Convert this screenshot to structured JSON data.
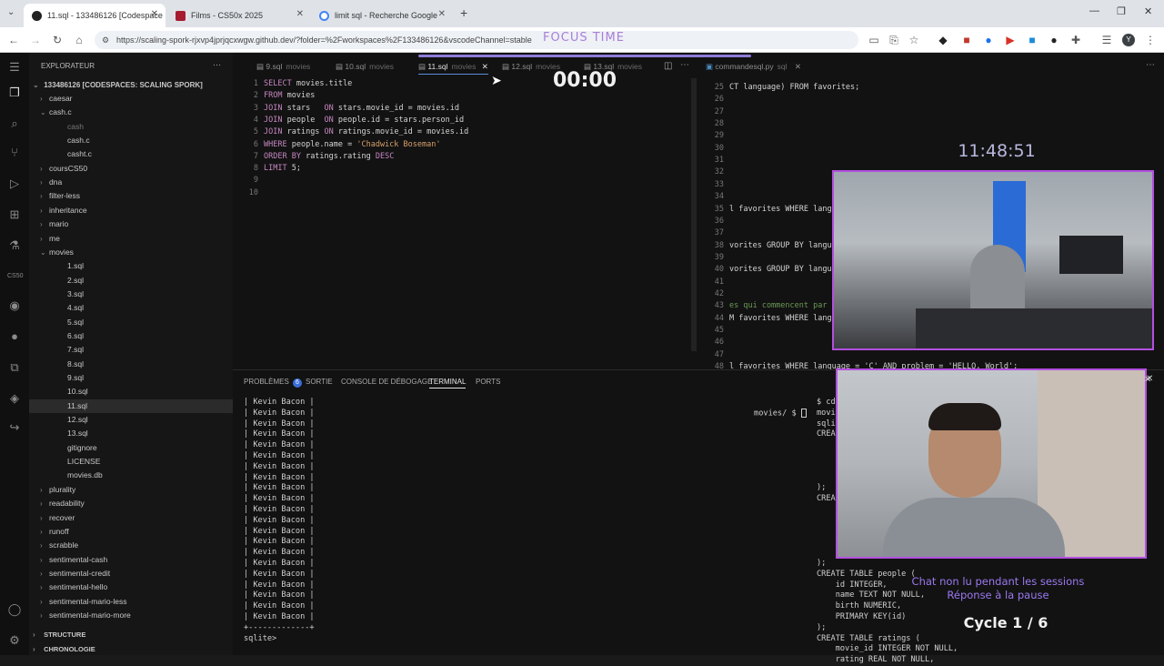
{
  "browser": {
    "tabs": [
      {
        "title": "11.sql - 133486126 [Codespace",
        "active": true
      },
      {
        "title": "Films - CS50x 2025",
        "active": false
      },
      {
        "title": "limit sql - Recherche Google",
        "active": false
      }
    ],
    "url": "https://scaling-spork-rjxvp4jprjqcxwgw.github.dev/?folder=%2Fworkspaces%2F133486126&vscodeChannel=stable"
  },
  "overlay": {
    "focus_label": "FOCUS TIME",
    "timer": "00:00",
    "clock": "11:48:51",
    "chat_line1": "Chat non lu pendant les sessions",
    "chat_line2": "Réponse à la pause",
    "cycle": "Cycle 1 / 6"
  },
  "sidebar": {
    "title": "EXPLORATEUR",
    "root": "133486126 [CODESPACES: SCALING SPORK]",
    "items": [
      {
        "label": "caesar",
        "depth": 1,
        "type": "folder",
        "open": false
      },
      {
        "label": "cash.c",
        "depth": 1,
        "type": "folder",
        "open": true
      },
      {
        "label": "cash",
        "depth": 2,
        "type": "file",
        "dim": true
      },
      {
        "label": "cash.c",
        "depth": 2,
        "type": "file"
      },
      {
        "label": "casht.c",
        "depth": 2,
        "type": "file"
      },
      {
        "label": "coursCS50",
        "depth": 1,
        "type": "folder",
        "open": false
      },
      {
        "label": "dna",
        "depth": 1,
        "type": "folder",
        "open": false
      },
      {
        "label": "filter-less",
        "depth": 1,
        "type": "folder",
        "open": false
      },
      {
        "label": "inheritance",
        "depth": 1,
        "type": "folder",
        "open": false
      },
      {
        "label": "mario",
        "depth": 1,
        "type": "folder",
        "open": false
      },
      {
        "label": "me",
        "depth": 1,
        "type": "folder",
        "open": false
      },
      {
        "label": "movies",
        "depth": 1,
        "type": "folder",
        "open": true
      },
      {
        "label": "1.sql",
        "depth": 2,
        "type": "file"
      },
      {
        "label": "2.sql",
        "depth": 2,
        "type": "file"
      },
      {
        "label": "3.sql",
        "depth": 2,
        "type": "file"
      },
      {
        "label": "4.sql",
        "depth": 2,
        "type": "file"
      },
      {
        "label": "5.sql",
        "depth": 2,
        "type": "file"
      },
      {
        "label": "6.sql",
        "depth": 2,
        "type": "file"
      },
      {
        "label": "7.sql",
        "depth": 2,
        "type": "file"
      },
      {
        "label": "8.sql",
        "depth": 2,
        "type": "file"
      },
      {
        "label": "9.sql",
        "depth": 2,
        "type": "file"
      },
      {
        "label": "10.sql",
        "depth": 2,
        "type": "file"
      },
      {
        "label": "11.sql",
        "depth": 2,
        "type": "file",
        "selected": true
      },
      {
        "label": "12.sql",
        "depth": 2,
        "type": "file"
      },
      {
        "label": "13.sql",
        "depth": 2,
        "type": "file"
      },
      {
        "label": "gitignore",
        "depth": 2,
        "type": "file"
      },
      {
        "label": "LICENSE",
        "depth": 2,
        "type": "file"
      },
      {
        "label": "movies.db",
        "depth": 2,
        "type": "file"
      },
      {
        "label": "plurality",
        "depth": 1,
        "type": "folder",
        "open": false
      },
      {
        "label": "readability",
        "depth": 1,
        "type": "folder",
        "open": false
      },
      {
        "label": "recover",
        "depth": 1,
        "type": "folder",
        "open": false
      },
      {
        "label": "runoff",
        "depth": 1,
        "type": "folder",
        "open": false
      },
      {
        "label": "scrabble",
        "depth": 1,
        "type": "folder",
        "open": false
      },
      {
        "label": "sentimental-cash",
        "depth": 1,
        "type": "folder",
        "open": false
      },
      {
        "label": "sentimental-credit",
        "depth": 1,
        "type": "folder",
        "open": false
      },
      {
        "label": "sentimental-hello",
        "depth": 1,
        "type": "folder",
        "open": false
      },
      {
        "label": "sentimental-mario-less",
        "depth": 1,
        "type": "folder",
        "open": false
      },
      {
        "label": "sentimental-mario-more",
        "depth": 1,
        "type": "folder",
        "open": false
      }
    ],
    "structure": "STRUCTURE",
    "timeline": "CHRONOLOGIE"
  },
  "editor_left": {
    "tabs": [
      {
        "name": "9.sql",
        "desc": "movies"
      },
      {
        "name": "10.sql",
        "desc": "movies"
      },
      {
        "name": "11.sql",
        "desc": "movies",
        "active": true
      },
      {
        "name": "12.sql",
        "desc": "movies"
      },
      {
        "name": "13.sql",
        "desc": "movies"
      }
    ],
    "lines": [
      {
        "n": "1",
        "tokens": [
          [
            "kw",
            "SELECT"
          ],
          [
            "plain",
            " movies.title"
          ]
        ]
      },
      {
        "n": "2",
        "tokens": [
          [
            "kw",
            "FROM"
          ],
          [
            "plain",
            " movies"
          ]
        ]
      },
      {
        "n": "3",
        "tokens": [
          [
            "kw",
            "JOIN"
          ],
          [
            "plain",
            " stars   "
          ],
          [
            "kw",
            "ON"
          ],
          [
            "plain",
            " stars.movie_id = movies.id"
          ]
        ]
      },
      {
        "n": "4",
        "tokens": [
          [
            "kw",
            "JOIN"
          ],
          [
            "plain",
            " people  "
          ],
          [
            "kw",
            "ON"
          ],
          [
            "plain",
            " people.id = stars.person_id"
          ]
        ]
      },
      {
        "n": "5",
        "tokens": [
          [
            "kw",
            "JOIN"
          ],
          [
            "plain",
            " ratings "
          ],
          [
            "kw",
            "ON"
          ],
          [
            "plain",
            " ratings.movie_id = movies.id"
          ]
        ]
      },
      {
        "n": "6",
        "tokens": [
          [
            "kw",
            "WHERE"
          ],
          [
            "plain",
            " people.name = "
          ],
          [
            "str",
            "'Chadwick Boseman'"
          ]
        ]
      },
      {
        "n": "7",
        "tokens": [
          [
            "kw",
            "ORDER BY"
          ],
          [
            "plain",
            " ratings.rating "
          ],
          [
            "kw",
            "DESC"
          ]
        ]
      },
      {
        "n": "8",
        "tokens": [
          [
            "kw",
            "LIMIT"
          ],
          [
            "plain",
            " 5;"
          ]
        ]
      },
      {
        "n": "9",
        "tokens": []
      },
      {
        "n": "10",
        "tokens": []
      }
    ]
  },
  "editor_right": {
    "tab": {
      "name": "commandesql.py",
      "desc": "sql"
    },
    "lines": [
      {
        "n": "25",
        "text": "CT language) FROM favorites;"
      },
      {
        "n": "26",
        "text": ""
      },
      {
        "n": "27",
        "text": ""
      },
      {
        "n": "28",
        "text": ""
      },
      {
        "n": "29",
        "text": ""
      },
      {
        "n": "30",
        "text": ""
      },
      {
        "n": "31",
        "text": ""
      },
      {
        "n": "32",
        "text": ""
      },
      {
        "n": "33",
        "text": ""
      },
      {
        "n": "34",
        "text": ""
      },
      {
        "n": "35",
        "text": "l favorites WHERE langu"
      },
      {
        "n": "36",
        "text": ""
      },
      {
        "n": "37",
        "text": ""
      },
      {
        "n": "38",
        "text": "vorites GROUP BY langu"
      },
      {
        "n": "39",
        "text": ""
      },
      {
        "n": "40",
        "text": "vorites GROUP BY langu"
      },
      {
        "n": "41",
        "text": ""
      },
      {
        "n": "42",
        "text": ""
      },
      {
        "n": "43",
        "text": "es qui commencent par"
      },
      {
        "n": "44",
        "text": "M favorites WHERE lang"
      },
      {
        "n": "45",
        "text": ""
      },
      {
        "n": "46",
        "text": ""
      },
      {
        "n": "47",
        "text": ""
      },
      {
        "n": "48",
        "text": "l favorites WHERE language = 'C' AND problem = 'HELLO, World';"
      }
    ]
  },
  "panel": {
    "tabs": [
      "PROBLÈMES",
      "SORTIE",
      "CONSOLE DE DÉBOGAGE",
      "TERMINAL",
      "PORTS"
    ],
    "problems_count": "6",
    "active_tab": "TERMINAL",
    "terminal_left_lines": [
      "| Kevin Bacon |",
      "| Kevin Bacon |",
      "| Kevin Bacon |",
      "| Kevin Bacon |",
      "| Kevin Bacon |",
      "| Kevin Bacon |",
      "| Kevin Bacon |",
      "| Kevin Bacon |",
      "| Kevin Bacon |",
      "| Kevin Bacon |",
      "| Kevin Bacon |",
      "| Kevin Bacon |",
      "| Kevin Bacon |",
      "| Kevin Bacon |",
      "| Kevin Bacon |",
      "| Kevin Bacon |",
      "| Kevin Bacon |",
      "| Kevin Bacon |",
      "| Kevin Bacon |",
      "| Kevin Bacon |",
      "| Kevin Bacon |",
      "+-------------+",
      "sqlite> "
    ],
    "terminal_mid": "movies/ $ ",
    "terminal_right_lines": [
      "$ cd",
      "movi",
      "sqli",
      "CREA",
      "",
      "",
      "",
      "",
      ");",
      "CREA",
      "",
      "",
      "",
      "",
      "",
      ");",
      "CREATE TABLE people (",
      "    id INTEGER,",
      "    name TEXT NOT NULL,",
      "    birth NUMERIC,",
      "    PRIMARY KEY(id)",
      ");",
      "CREATE TABLE ratings (",
      "    movie_id INTEGER NOT NULL,",
      "    rating REAL NOT NULL,"
    ]
  }
}
